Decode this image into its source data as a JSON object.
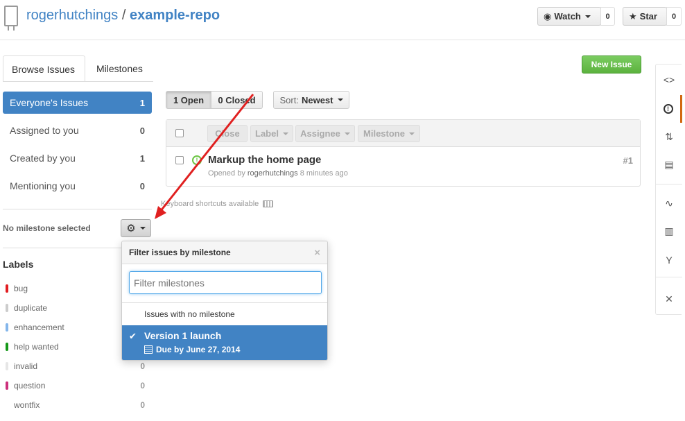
{
  "repo": {
    "owner": "rogerhutchings",
    "separator": "/",
    "name": "example-repo"
  },
  "header": {
    "watch": {
      "label": "Watch",
      "count": "0"
    },
    "star": {
      "label": "Star",
      "count": "0"
    }
  },
  "tabs": [
    {
      "label": "Browse Issues"
    },
    {
      "label": "Milestones"
    }
  ],
  "new_issue_label": "New Issue",
  "filters": [
    {
      "label": "Everyone's Issues",
      "count": "1"
    },
    {
      "label": "Assigned to you",
      "count": "0"
    },
    {
      "label": "Created by you",
      "count": "1"
    },
    {
      "label": "Mentioning you",
      "count": "0"
    }
  ],
  "milestone": {
    "status": "No milestone selected"
  },
  "labels": {
    "heading": "Labels",
    "items": [
      {
        "name": "bug",
        "color": "#e11d21",
        "count": ""
      },
      {
        "name": "duplicate",
        "color": "#cccccc",
        "count": ""
      },
      {
        "name": "enhancement",
        "color": "#84b6eb",
        "count": ""
      },
      {
        "name": "help wanted",
        "color": "#159818",
        "count": ""
      },
      {
        "name": "invalid",
        "color": "#e6e6e6",
        "count": "0"
      },
      {
        "name": "question",
        "color": "#cc317c",
        "count": "0"
      },
      {
        "name": "wontfix",
        "color": "#ffffff",
        "count": "0"
      }
    ]
  },
  "toolbar": {
    "open_label": "1 Open",
    "closed_label": "0 Closed",
    "sort_key": "Sort:",
    "sort_value": "Newest"
  },
  "table_actions": {
    "close": "Close",
    "label": "Label",
    "assignee": "Assignee",
    "milestone": "Milestone"
  },
  "issues": [
    {
      "title": "Markup the home page",
      "opened_by": "Opened by",
      "author": "rogerhutchings",
      "time": "8 minutes ago",
      "number": "#1"
    }
  ],
  "keyboard_hint": "Keyboard shortcuts available",
  "milestone_popup": {
    "title": "Filter issues by milestone",
    "close": "×",
    "filter_placeholder": "Filter milestones",
    "no_milestone": "Issues with no milestone",
    "items": [
      {
        "name": "Version 1 launch",
        "due": "Due by June 27, 2014"
      }
    ]
  },
  "right_nav": [
    {
      "icon": "code-icon",
      "glyph": "<>"
    },
    {
      "icon": "issues-icon",
      "glyph": "!"
    },
    {
      "icon": "pull-request-icon",
      "glyph": "⇅"
    },
    {
      "icon": "wiki-icon",
      "glyph": "▤"
    },
    {
      "icon": "pulse-icon",
      "glyph": "∿"
    },
    {
      "icon": "graphs-icon",
      "glyph": "▥"
    },
    {
      "icon": "network-icon",
      "glyph": "Y"
    },
    {
      "icon": "settings-icon",
      "glyph": "✕"
    }
  ],
  "colors": {
    "accent": "#4183c4",
    "success": "#6cc644",
    "annotation": "#e02020",
    "nav_active": "#d26911"
  }
}
